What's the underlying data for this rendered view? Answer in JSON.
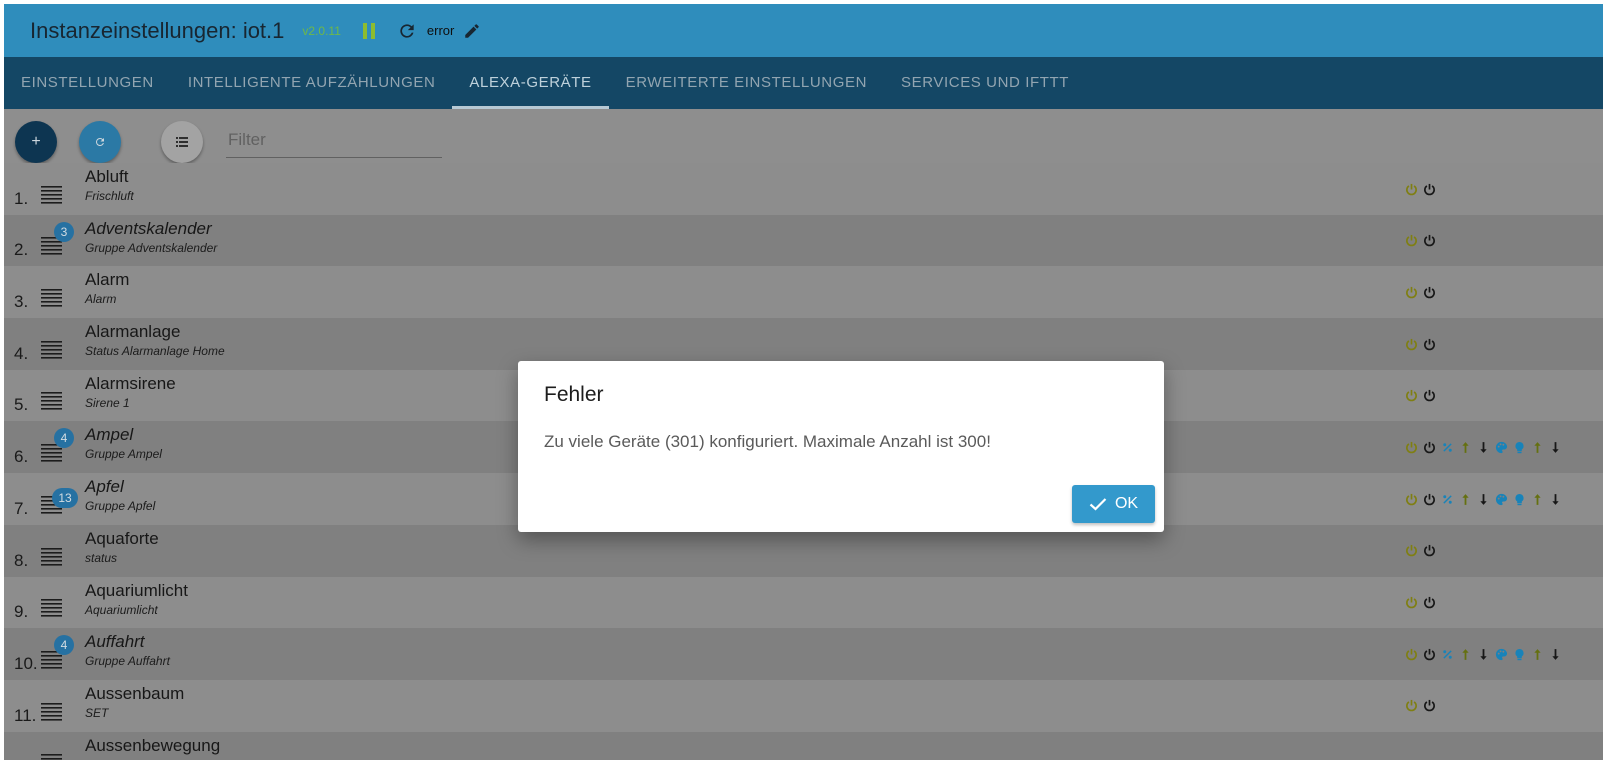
{
  "header": {
    "title": "Instanzeinstellungen: iot.1",
    "version": "v2.0.11",
    "status": "error",
    "icons": [
      "pause-icon",
      "refresh-icon",
      "edit-icon"
    ]
  },
  "tabs": [
    {
      "label": "EINSTELLUNGEN",
      "active": false
    },
    {
      "label": "INTELLIGENTE AUFZÄHLUNGEN",
      "active": false
    },
    {
      "label": "ALEXA-GERÄTE",
      "active": true
    },
    {
      "label": "ERWEITERTE EINSTELLUNGEN",
      "active": false
    },
    {
      "label": "SERVICES UND IFTTT",
      "active": false
    }
  ],
  "toolbar": {
    "add_label": "+",
    "refresh_label": "↻",
    "filter_placeholder": "Filter"
  },
  "devices": [
    {
      "num": "1.",
      "name": "Abluft",
      "sub": "Frischluft",
      "group": false,
      "count": null,
      "icons": [
        "power-on",
        "power-off"
      ]
    },
    {
      "num": "2.",
      "name": "Adventskalender",
      "sub": "Gruppe Adventskalender",
      "group": true,
      "count": "3",
      "icons": [
        "power-on",
        "power-off"
      ]
    },
    {
      "num": "3.",
      "name": "Alarm",
      "sub": "Alarm",
      "group": false,
      "count": null,
      "icons": [
        "power-on",
        "power-off"
      ]
    },
    {
      "num": "4.",
      "name": "Alarmanlage",
      "sub": "Status Alarmanlage Home",
      "group": false,
      "count": null,
      "icons": [
        "power-on",
        "power-off"
      ]
    },
    {
      "num": "5.",
      "name": "Alarmsirene",
      "sub": "Sirene 1",
      "group": false,
      "count": null,
      "icons": [
        "power-on",
        "power-off"
      ]
    },
    {
      "num": "6.",
      "name": "Ampel",
      "sub": "Gruppe Ampel",
      "group": true,
      "count": "4",
      "icons": [
        "power-on",
        "power-off",
        "percent",
        "arrow-up",
        "arrow-down",
        "palette",
        "bulb",
        "arrow-up",
        "arrow-down"
      ]
    },
    {
      "num": "7.",
      "name": "Apfel",
      "sub": "Gruppe Apfel",
      "group": true,
      "count": "13",
      "icons": [
        "power-on",
        "power-off",
        "percent",
        "arrow-up",
        "arrow-down",
        "palette",
        "bulb",
        "arrow-up",
        "arrow-down"
      ]
    },
    {
      "num": "8.",
      "name": "Aquaforte",
      "sub": "status",
      "group": false,
      "count": null,
      "icons": [
        "power-on",
        "power-off"
      ]
    },
    {
      "num": "9.",
      "name": "Aquariumlicht",
      "sub": "Aquariumlicht",
      "group": false,
      "count": null,
      "icons": [
        "power-on",
        "power-off"
      ]
    },
    {
      "num": "10.",
      "name": "Auffahrt",
      "sub": "Gruppe Auffahrt",
      "group": true,
      "count": "4",
      "icons": [
        "power-on",
        "power-off",
        "percent",
        "arrow-up",
        "arrow-down",
        "palette",
        "bulb",
        "arrow-up",
        "arrow-down"
      ]
    },
    {
      "num": "11.",
      "name": "Aussenbaum",
      "sub": "SET",
      "group": false,
      "count": null,
      "icons": [
        "power-on",
        "power-off"
      ]
    },
    {
      "num": "",
      "name": "Aussenbewegung",
      "sub": "",
      "group": false,
      "count": null,
      "icons": []
    }
  ],
  "dialog": {
    "title": "Fehler",
    "message": "Zu viele Geräte (301) konfiguriert. Maximale Anzahl ist 300!",
    "ok_label": "OK"
  },
  "colors": {
    "header": "#3399cc",
    "tabs": "#164e6e",
    "accent": "#3399cc",
    "power_on": "#8a8a14",
    "power_off": "#1a1a1a",
    "icon_blue": "#1b8fc9",
    "icon_olive": "#6e7a12"
  }
}
